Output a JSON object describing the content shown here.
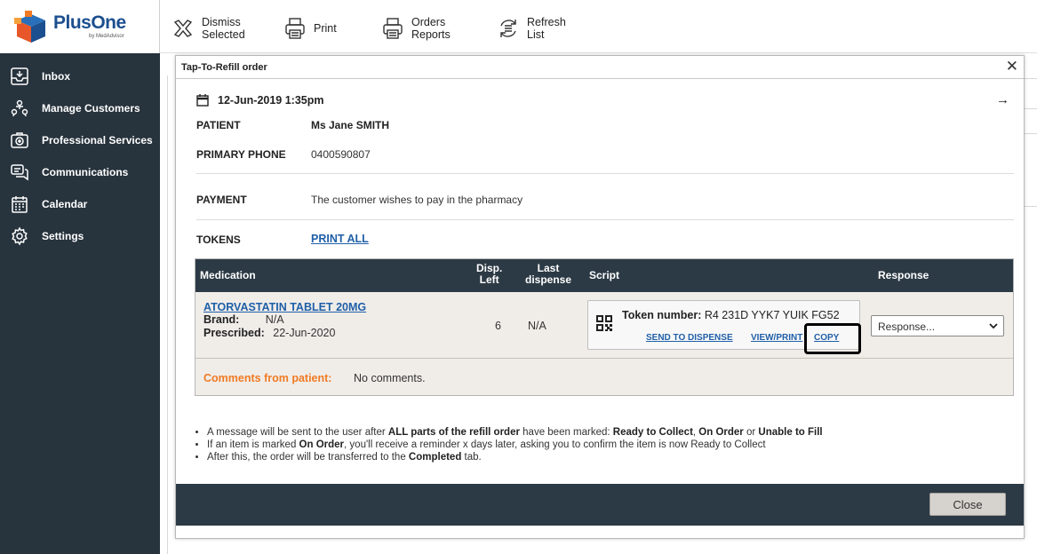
{
  "brand": {
    "name": "PlusOne",
    "tagline": "by MedAdvisor",
    "colors": {
      "primary": "#1c4f8f",
      "accent": "#f07b24",
      "dark": "#27333d"
    }
  },
  "sidebar": {
    "items": [
      {
        "label": "Inbox",
        "icon": "inbox-icon"
      },
      {
        "label": "Manage Customers",
        "icon": "customers-icon"
      },
      {
        "label": "Professional Services",
        "icon": "medical-kit-icon"
      },
      {
        "label": "Communications",
        "icon": "chat-icon"
      },
      {
        "label": "Calendar",
        "icon": "calendar-icon"
      },
      {
        "label": "Settings",
        "icon": "gear-icon"
      }
    ]
  },
  "toolbar": {
    "dismiss": "Dismiss\nSelected",
    "print": "Print",
    "orders_reports": "Orders\nReports",
    "refresh": "Refresh\nList"
  },
  "modal": {
    "title": "Tap-To-Refill order",
    "date": "12-Jun-2019 1:35pm",
    "patient_label": "PATIENT",
    "patient_value": "Ms Jane SMITH",
    "phone_label": "PRIMARY PHONE",
    "phone_value": "0400590807",
    "payment_label": "PAYMENT",
    "payment_value": "The customer wishes to pay in the pharmacy",
    "tokens_label": "TOKENS",
    "tokens_link": "PRINT ALL",
    "table": {
      "headers": {
        "medication": "Medication",
        "disp_left": "Disp.\nLeft",
        "last_dispense": "Last\ndispense",
        "script": "Script",
        "response": "Response"
      },
      "row": {
        "name": "ATORVASTATIN TABLET 20MG",
        "brand_label": "Brand:",
        "brand_value": "N/A",
        "prescribed_label": "Prescribed:",
        "prescribed_value": "22-Jun-2020",
        "disp_left": "6",
        "last_dispense": "N/A",
        "token_label": "Token number:",
        "token_value": "R4 231D YYK7 YUIK FG52",
        "send_link": "SEND TO DISPENSE",
        "view_link": "VIEW/PRINT",
        "copy_link": "COPY",
        "response_placeholder": "Response..."
      },
      "comments_label": "Comments from patient:",
      "comments_value": "No comments."
    },
    "notes": {
      "n1_a": "A message will be sent to the user after ",
      "n1_b": "ALL parts of the refill order",
      "n1_c": " have been marked: ",
      "n1_d": "Ready to Collect",
      "n1_e": ", ",
      "n1_f": "On Order",
      "n1_g": " or ",
      "n1_h": "Unable to Fill",
      "n2_a": "If an item is marked ",
      "n2_b": "On Order",
      "n2_c": ", you'll receive a reminder x days later, asking you to confirm the item is now Ready to Collect",
      "n3_a": "After this, the order will be transferred to the ",
      "n3_b": "Completed",
      "n3_c": " tab."
    },
    "close_label": "Close"
  }
}
